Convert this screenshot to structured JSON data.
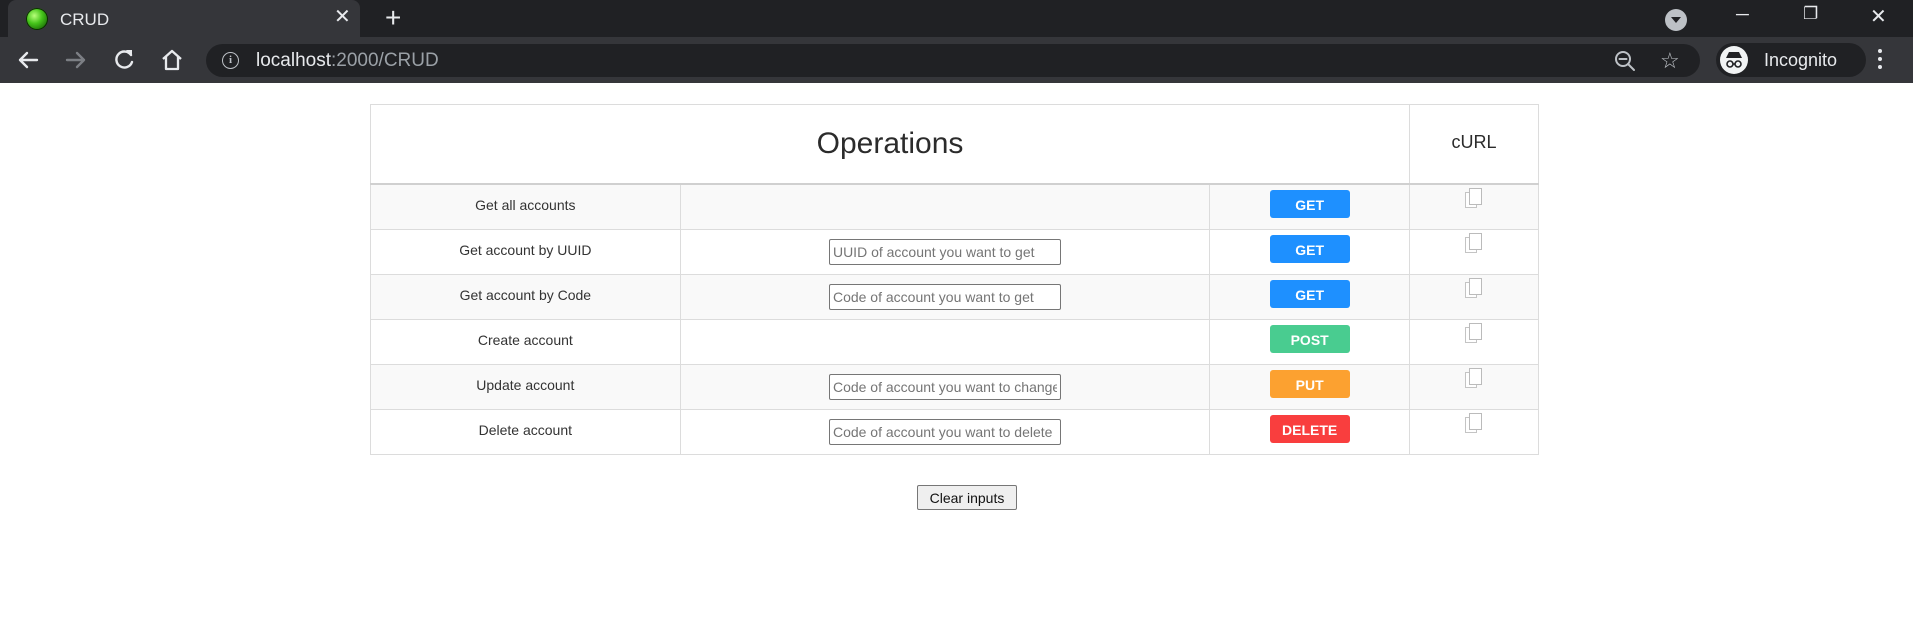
{
  "browser": {
    "tab_title": "CRUD",
    "url_host": "localhost",
    "url_rest": ":2000/CRUD",
    "profile_label": "Incognito"
  },
  "table": {
    "header_operations": "Operations",
    "header_curl": "cURL",
    "rows": [
      {
        "label": "Get all accounts",
        "placeholder": "",
        "method": "GET",
        "method_color": "#1e90ff"
      },
      {
        "label": "Get account by UUID",
        "placeholder": "UUID of account you want to get",
        "method": "GET",
        "method_color": "#1e90ff"
      },
      {
        "label": "Get account by Code",
        "placeholder": "Code of account you want to get",
        "method": "GET",
        "method_color": "#1e90ff"
      },
      {
        "label": "Create account",
        "placeholder": "",
        "method": "POST",
        "method_color": "#49cc90"
      },
      {
        "label": "Update account",
        "placeholder": "Code of account you want to change",
        "method": "PUT",
        "method_color": "#fca130"
      },
      {
        "label": "Delete account",
        "placeholder": "Code of account you want to delete",
        "method": "DELETE",
        "method_color": "#f93e3e"
      }
    ]
  },
  "clear_button_label": "Clear inputs"
}
